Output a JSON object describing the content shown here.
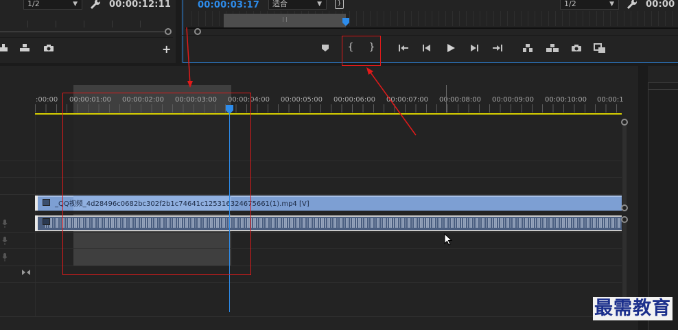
{
  "source_monitor": {
    "zoom_label": "1/2",
    "timecode": "00:00:12:11"
  },
  "program_monitor": {
    "timecode": "00:00:03:17",
    "fit_label": "适合",
    "zoom_label": "1/2",
    "timecode_partial": "00:00"
  },
  "add_button_label": "+",
  "timeline": {
    "ruler_labels": [
      ":00:00",
      "00:00:01:00",
      "00:00:02:00",
      "00:00:03:00",
      "00:00:04:00",
      "00:00:05:00",
      "00:00:06:00",
      "00:00:07:00",
      "00:00:08:00",
      "00:00:09:00",
      "00:00:10:00",
      "00:00:1"
    ],
    "video_clip_label": "_QQ视频_4d28496c0682bc302f2b1c74641c125316324675661(1).mp4 [V]"
  },
  "watermark": "最需教育",
  "colors": {
    "accent_blue": "#2d8ceb",
    "annotation_red": "#e21a1a",
    "video_clip": "#7d9fd3",
    "audio_clip": "#4a5e80",
    "in_out_range": "#404040",
    "work_area": "#d8d000"
  }
}
